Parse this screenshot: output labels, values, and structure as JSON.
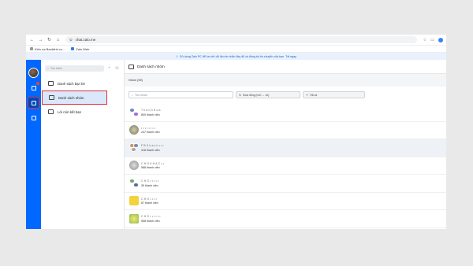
{
  "browser": {
    "url": "chat.zalo.me",
    "bookmarks": [
      "Kiến nạ Backlink cu...",
      "Zalo Web"
    ]
  },
  "banner": {
    "text": "Sử dụng Zalo PC để lưu trữ dữ liệu tin nhắn đầy đủ và đồng bộ tin chuyển của bạn",
    "link": "Tải ngay"
  },
  "sidebar": {
    "search_placeholder": "Tìm kiếm",
    "items": [
      {
        "label": "Danh sách bạn bè"
      },
      {
        "label": "Danh sách nhóm"
      },
      {
        "label": "Lời mời kết bạn"
      }
    ]
  },
  "main": {
    "header_title": "Danh sách nhóm",
    "section_title": "Nhóm (59)",
    "search_placeholder": "Tìm nhóm",
    "sort_label": "Hoạt động (mới → cũ)",
    "filter_label": "Tất cả"
  },
  "groups": [
    {
      "name": "T h a n h  H o a",
      "members": "800 thành viên",
      "avatar": "pair-blue"
    },
    {
      "name": "• • • • • • • •",
      "members": "247 thành viên",
      "avatar": "photo-teal"
    },
    {
      "name": "F B  K h a c h  • • •",
      "members": "318 thành viên",
      "avatar": "pair-orange"
    },
    {
      "name": "C H O  K H A C  • •",
      "members": "588 thành viên",
      "avatar": "photo-grey"
    },
    {
      "name": "C H O  • • • • •",
      "members": "35 thành viên",
      "avatar": "pair-green"
    },
    {
      "name": "C H O  • • • •",
      "members": "87 thành viên",
      "avatar": "yellow"
    },
    {
      "name": "C H O  • • • •  • •",
      "members": "558 thành viên",
      "avatar": "flowers"
    }
  ],
  "colors": {
    "rail": "#0068ff",
    "active_item": "#dbe8fb",
    "highlight_outline": "#e0303a"
  }
}
